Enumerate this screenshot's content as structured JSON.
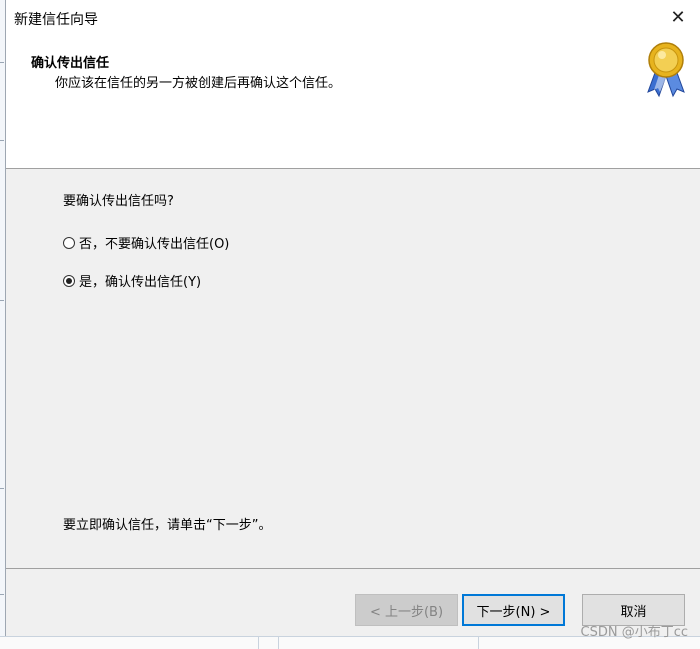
{
  "window": {
    "title": "新建信任向导"
  },
  "header": {
    "title": "确认传出信任",
    "subtitle": "你应该在信任的另一方被创建后再确认这个信任。"
  },
  "content": {
    "question": "要确认传出信任吗?",
    "options": [
      {
        "label": "否，不要确认传出信任(O)",
        "checked": false
      },
      {
        "label": "是，确认传出信任(Y)",
        "checked": true
      }
    ],
    "hint": "要立即确认信任，请单击“下一步”。"
  },
  "buttons": {
    "back": "< 上一步(B)",
    "next": "下一步(N) >",
    "cancel": "取消"
  },
  "watermark": "CSDN @小布丁cc",
  "colors": {
    "accent": "#0078d7",
    "ribbon": "#3b6fd1",
    "medal": "#e7b31e"
  }
}
